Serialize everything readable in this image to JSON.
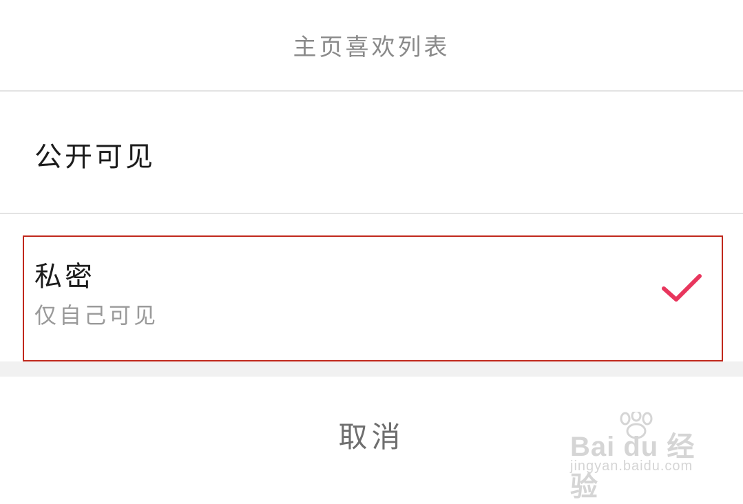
{
  "sheet": {
    "title": "主页喜欢列表"
  },
  "options": [
    {
      "label": "公开可见",
      "selected": false
    },
    {
      "label": "私密",
      "sublabel": "仅自己可见",
      "selected": true,
      "check_icon": "checkmark-icon"
    }
  ],
  "cancel_label": "取消",
  "colors": {
    "accent_check": "#e8365d",
    "highlight_border": "#c0281c",
    "title_text": "#8a8a8a",
    "cancel_text": "#6e6e6e"
  },
  "watermark": {
    "brand": "Bai du 经验",
    "url": "jingyan.baidu.com"
  }
}
